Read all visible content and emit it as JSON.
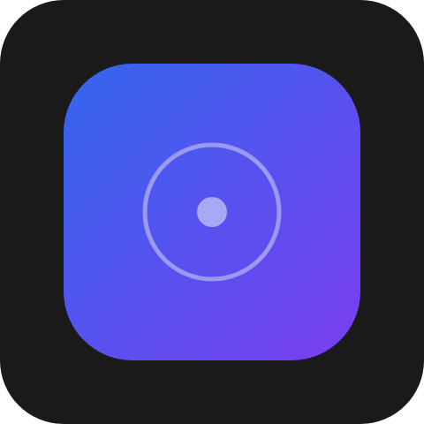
{
  "icon": {
    "name": "target-icon",
    "background_color": "#1a1a1a",
    "gradient_start_color": "#3366ee",
    "gradient_end_color": "#7a3ef0",
    "ring_color": "#9a9af0",
    "dot_color": "#a8a8f5"
  }
}
